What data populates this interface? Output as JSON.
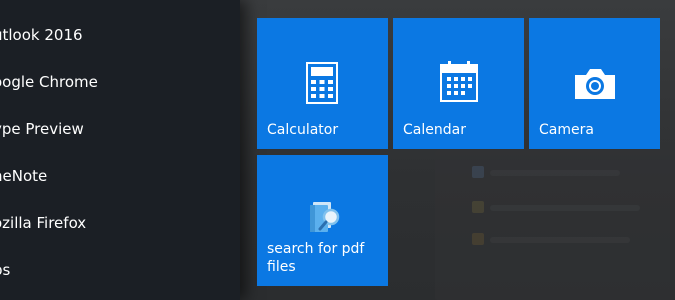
{
  "app_list": {
    "items": [
      {
        "label": "utlook 2016"
      },
      {
        "label": "oogle Chrome"
      },
      {
        "label": "ype Preview"
      },
      {
        "label": "neNote"
      },
      {
        "label": "ozilla Firefox"
      },
      {
        "label": "ps"
      }
    ]
  },
  "tiles": {
    "calculator": {
      "label": "Calculator",
      "icon": "calculator-icon"
    },
    "calendar": {
      "label": "Calendar",
      "icon": "calendar-icon"
    },
    "camera": {
      "label": "Camera",
      "icon": "camera-icon"
    },
    "search_pdf": {
      "label_line1": "search for pdf",
      "label_line2": "files",
      "icon": "search-document-icon"
    }
  },
  "colors": {
    "tile": "#0b78e3",
    "app_list_bg": "#1b1f25",
    "backdrop": "#2d2f31"
  }
}
